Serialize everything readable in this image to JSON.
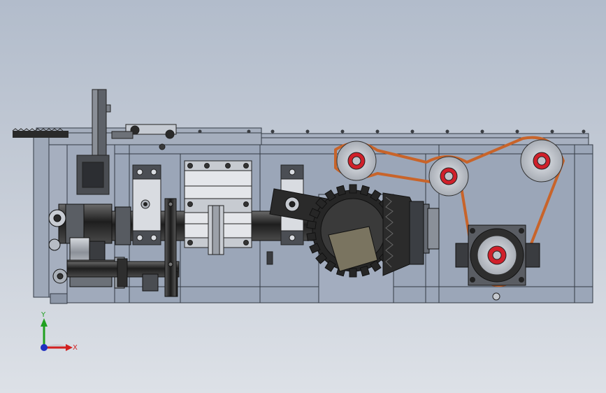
{
  "viewport": {
    "background_top": "#b2bccb",
    "background_bottom": "#dde1e7"
  },
  "triad": {
    "x_label": "X",
    "y_label": "Y",
    "x_color": "#d22020",
    "y_color": "#20a020",
    "z_color": "#2030c0"
  },
  "colors": {
    "frame_fill": "#9aa5b8",
    "frame_line": "#333a44",
    "belt": "#c8642a",
    "shaft": "#3a3a3a",
    "bearing_red": "#d0202a",
    "gear_dark": "#2b2b2b",
    "plate_dark": "#4a4a4a"
  }
}
